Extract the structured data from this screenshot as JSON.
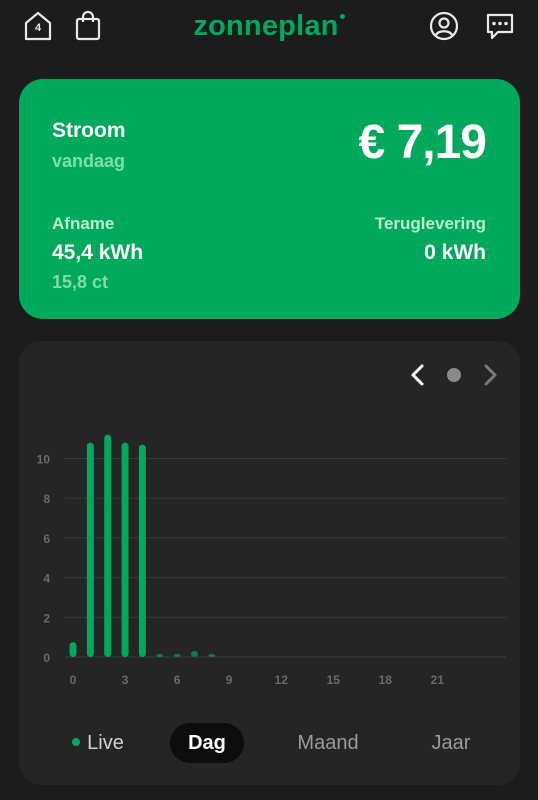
{
  "header": {
    "home_badge": "4",
    "logo_text": "zonneplan",
    "icons": [
      "home-icon",
      "shopping-bag-icon",
      "profile-icon",
      "chat-icon"
    ]
  },
  "summary": {
    "title": "Stroom",
    "subtitle": "vandaag",
    "total": "€ 7,19",
    "afname_label": "Afname",
    "afname_value": "45,4 kWh",
    "afname_price": "15,8 ct",
    "teruglevering_label": "Teruglevering",
    "teruglevering_value": "0 kWh"
  },
  "colors": {
    "accent": "#00a95c",
    "background": "#1c1c1c",
    "card": "#252525"
  },
  "chart_data": {
    "type": "bar",
    "x_ticks": [
      "0",
      "3",
      "6",
      "9",
      "12",
      "15",
      "18",
      "21"
    ],
    "y_ticks": [
      "0",
      "2",
      "4",
      "6",
      "8",
      "10"
    ],
    "ylim": [
      0,
      12
    ],
    "xlim": [
      0,
      24
    ],
    "x": [
      0,
      1,
      2,
      3,
      4,
      5,
      6,
      7,
      8
    ],
    "values": [
      0.75,
      10.8,
      11.2,
      10.8,
      10.7,
      0.15,
      0.15,
      0.3,
      0.12
    ],
    "grid": true
  },
  "tabs": [
    {
      "label": "Live",
      "selected": false
    },
    {
      "label": "Dag",
      "selected": true
    },
    {
      "label": "Maand",
      "selected": false
    },
    {
      "label": "Jaar",
      "selected": false
    }
  ]
}
